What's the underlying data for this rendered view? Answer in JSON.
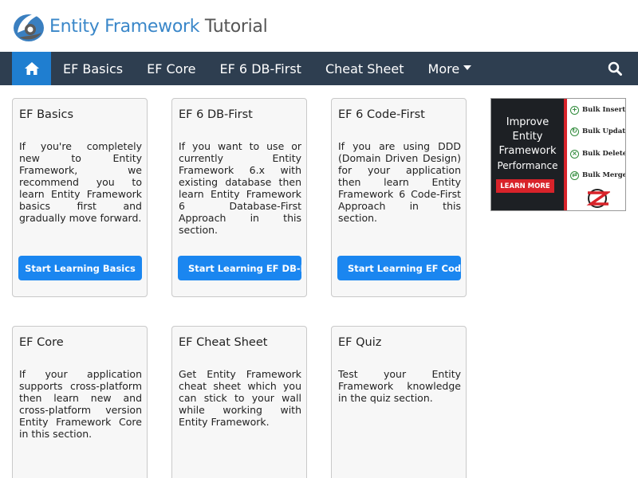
{
  "site": {
    "logo_text_blue": "Entity Framework",
    "logo_text_gray": "Tutorial"
  },
  "nav": {
    "home_icon": "home-icon",
    "items": [
      "EF Basics",
      "EF Core",
      "EF 6 DB-First",
      "Cheat Sheet",
      "More"
    ],
    "search_icon": "search-icon"
  },
  "cards": [
    {
      "title": "EF Basics",
      "text": "If you're completely new to Entity Framework, we recommend you to learn Entity Framework basics first and gradually move forward.",
      "button": "Start Learning Basics"
    },
    {
      "title": "EF 6 DB-First",
      "text": "If you want to use or currently Entity Framework 6.x with existing database then learn Entity Framework 6 Database-First Approach in this section.",
      "button": "Start Learning EF DB-First"
    },
    {
      "title": "EF 6 Code-First",
      "text": "If you are using DDD (Domain Driven Design) for your application then learn Entity Framework 6 Code-First Approach in this section.",
      "button": "Start Learning EF Code-First"
    },
    {
      "title": "EF Core",
      "text": "If your application supports cross-platform then learn new and cross-platform version Entity Framework Core in this section."
    },
    {
      "title": "EF Cheat Sheet",
      "text": "Get Entity Framework cheat sheet which you can stick to your wall while working with Entity Framework."
    },
    {
      "title": "EF Quiz",
      "text": "Test your Entity Framework knowledge in the quiz section."
    }
  ],
  "ad": {
    "headline": [
      "Improve",
      "Entity",
      "Framework"
    ],
    "subline": "Performance",
    "cta": "LEARN MORE",
    "features": [
      "Bulk Insert",
      "Bulk Update",
      "Bulk Delete",
      "Bulk Merge"
    ],
    "feature_icons": [
      "plus-icon",
      "refresh-icon",
      "x-icon",
      "merge-icon"
    ]
  },
  "colors": {
    "navbar": "#2e3e50",
    "home_active": "#1f7ed0",
    "button": "#1a86f0",
    "brand_blue": "#3a87c9",
    "ad_red": "#d8232a"
  }
}
